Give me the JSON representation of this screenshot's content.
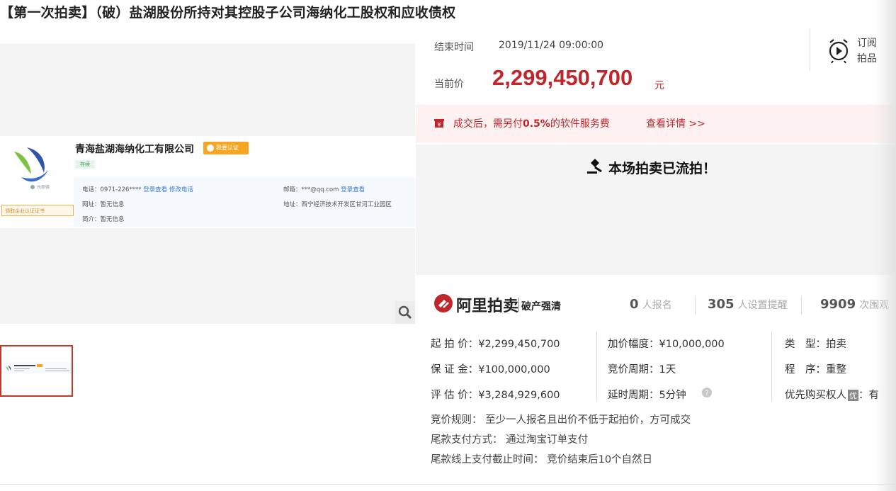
{
  "page": {
    "title": "【第一次拍卖】（破）盐湖股份所持对其控股子公司海纳化工股权和应收债权"
  },
  "auction": {
    "end_time_label": "结束时间",
    "end_time_value": "2019/11/24 09:00:00",
    "current_price_label": "当前价",
    "current_price_value": "2,299,450,700",
    "current_price_unit": "元",
    "subscribe_line1": "订阅",
    "subscribe_line2": "拍品",
    "fee_prefix": "成交后，需另付",
    "fee_percent": "0.5%",
    "fee_suffix": "的软件服务费",
    "fee_link": "查看详情 >>",
    "status_text": "本场拍卖已流拍！"
  },
  "gallery": {
    "company_name": "青海盐湖海纳化工有限公司",
    "verify_badge": "我要认证",
    "status_tag": "存续",
    "cert_link": "领取企业认证证书",
    "logo_caption": "元丽德",
    "phone_label": "电话：",
    "phone_value": "0971-226****",
    "phone_links": "登录查看 修改电话",
    "email_label": "邮箱：",
    "email_value": "***@qq.com",
    "email_link": "登录查看",
    "website_label": "网址：",
    "website_value": "暂无信息",
    "address_label": "地址：",
    "address_value": "西宁经济技术开发区甘河工业园区",
    "intro_label": "简介：",
    "intro_value": "暂无信息"
  },
  "brand": {
    "name": "阿里拍卖",
    "sub": "破产强清",
    "signup_count": "0",
    "signup_unit": "人报名",
    "reminder_count": "305",
    "reminder_unit": "人设置提醒",
    "watch_count": "9909",
    "watch_unit": "次围观"
  },
  "details": {
    "start_price": "起 拍 价：¥2,299,450,700",
    "deposit": "保 证 金：¥100,000,000",
    "appraisal": "评 估 价：¥3,284,929,600",
    "increment": "加价幅度：¥10,000,000",
    "bid_period": "竞价周期：1天",
    "extend_period": "延时周期：5分钟",
    "type_label": "类　型：",
    "type_value": "拍卖",
    "procedure_label": "程　序：",
    "procedure_value": "重整",
    "priority_label": "优先购买权人",
    "priority_badge": "优",
    "priority_value": "：有",
    "rule_bid": "竞价规则： 至少一人报名且出价不低于起拍价，方可成交",
    "rule_payment": "尾款支付方式： 通过淘宝订单支付",
    "rule_deadline": "尾款线上支付截止时间： 竞价结束后10个自然日"
  }
}
